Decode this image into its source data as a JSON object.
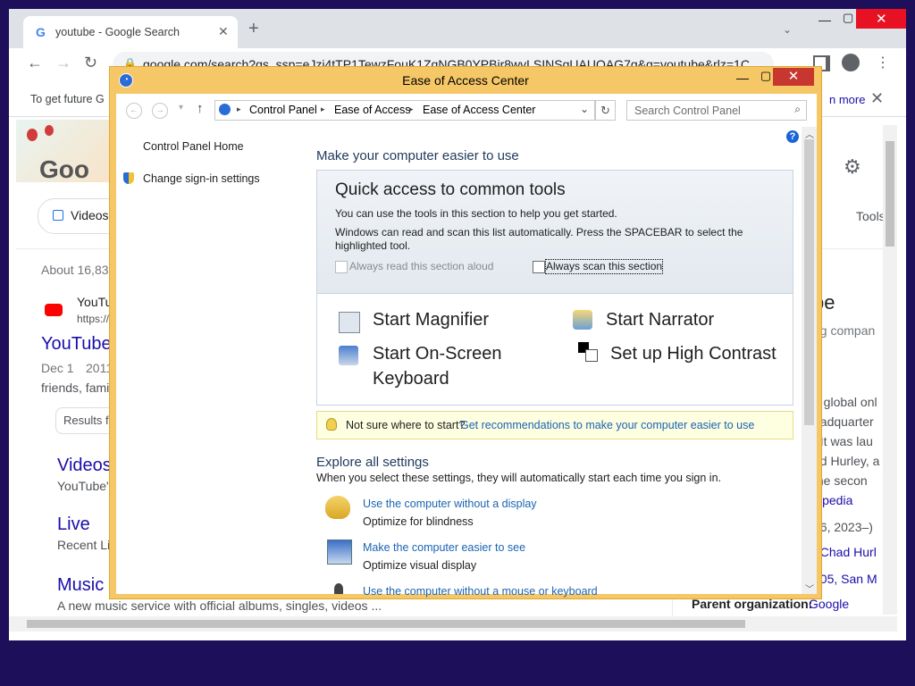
{
  "browser": {
    "tab_title": "youtube - Google Search",
    "url": "google.com/search?gs_ssp=eJzj4tTP1TewzFouK1ZgNGB0YPBir8wvLSINSgUAUQAG7g&q=youtube&rlz=1C",
    "infobar_text": "To get future G",
    "infobar_link": "n more"
  },
  "google_page": {
    "logo_text": "Goo",
    "videos_chip": "Videos",
    "tools": "Tools",
    "about": "About 16,830",
    "result_site": "YouTu",
    "result_url": "https://",
    "result_title": "YouTube",
    "result_snippet1": "Dec 1",
    "result_snippet1b": "2011",
    "result_snippet2": "friends, fami",
    "results_chip": "Results fo",
    "videos_title": "Videos",
    "videos_sub": "YouTube'",
    "live_title": "Live",
    "live_sub": "Recent Li",
    "music_title": "Music",
    "music_sub": "A new music service with official albums, singles, videos ...",
    "kp_title": "be",
    "kp_lines": [
      "ng compan",
      "n global onl",
      "eadquarter",
      ". It was lau",
      "ad Hurley, a",
      "the secon",
      "kipedia",
      "16, 2023–)",
      ", Chad Hurl",
      "005, San M"
    ],
    "kp_parent_label": "Parent organization:",
    "kp_parent_value": "Google"
  },
  "eoa": {
    "window_title": "Ease of Access Center",
    "breadcrumb": [
      "Control Panel",
      "Ease of Access",
      "Ease of Access Center"
    ],
    "search_placeholder": "Search Control Panel",
    "left_nav": {
      "home": "Control Panel Home",
      "signin": "Change sign-in settings"
    },
    "heading": "Make your computer easier to use",
    "quick_access": {
      "title": "Quick access to common tools",
      "p1": "You can use the tools in this section to help you get started.",
      "p2": "Windows can read and scan this list automatically.  Press the SPACEBAR to select the highlighted tool.",
      "cb_read": "Always read this section aloud",
      "cb_scan": "Always scan this section",
      "magnifier": "Start Magnifier",
      "narrator": "Start Narrator",
      "osk_line1": "Start On-Screen",
      "osk_line2": "Keyboard",
      "contrast": "Set up High Contrast"
    },
    "tip": {
      "text": "Not sure where to start?",
      "link": "Get recommendations to make your computer easier to use"
    },
    "explore": {
      "title": "Explore all settings",
      "desc": "When you select these settings, they will automatically start each time you sign in.",
      "items": [
        {
          "link": "Use the computer without a display",
          "sub": "Optimize for blindness"
        },
        {
          "link": "Make the computer easier to see",
          "sub": "Optimize visual display"
        },
        {
          "link": "Use the computer without a mouse or keyboard",
          "sub": ""
        }
      ]
    }
  }
}
